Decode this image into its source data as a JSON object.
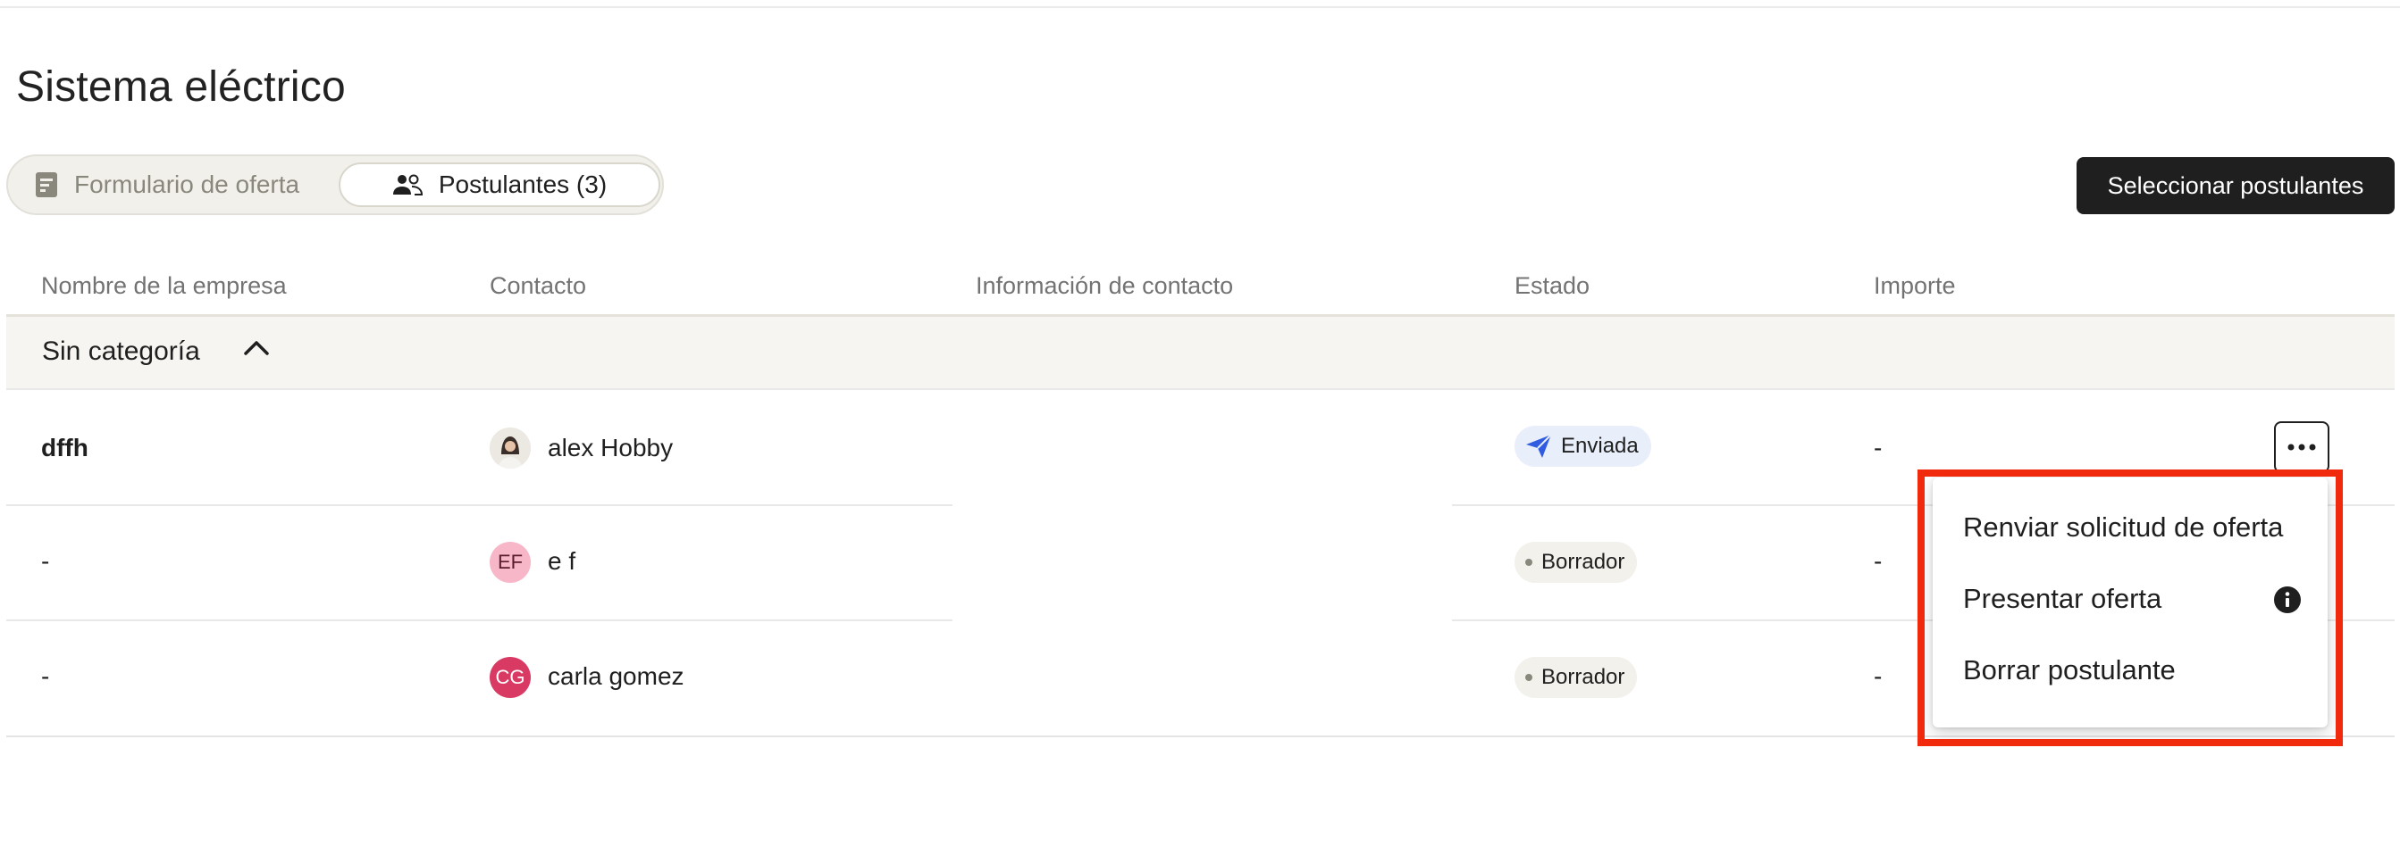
{
  "page": {
    "title": "Sistema eléctrico"
  },
  "tabs": [
    {
      "label": "Formulario de oferta",
      "icon": "form-document-icon",
      "active": false
    },
    {
      "label": "Postulantes (3)",
      "icon": "users-icon",
      "active": true
    }
  ],
  "actions": {
    "select_applicants": "Seleccionar postulantes"
  },
  "table": {
    "columns": [
      "Nombre de la empresa",
      "Contacto",
      "Información de contacto",
      "Estado",
      "Importe"
    ],
    "group": {
      "label": "Sin categoría",
      "expanded": true,
      "icon": "chevron-up-icon"
    },
    "rows": [
      {
        "company": "dffh",
        "contact": "alex Hobby",
        "avatar": "photo",
        "contact_info": "",
        "status": "Enviada",
        "status_icon": "paper-plane-icon",
        "amount": "-"
      },
      {
        "company": "-",
        "contact": "e f",
        "avatar": "EF",
        "contact_info": "",
        "status": "Borrador",
        "status_icon": "dot-icon",
        "amount": "-"
      },
      {
        "company": "-",
        "contact": "carla gomez",
        "avatar": "CG",
        "contact_info": "",
        "status": "Borrador",
        "status_icon": "dot-icon",
        "amount": "-"
      }
    ]
  },
  "menu": {
    "items": [
      {
        "label": "Renviar solicitud de oferta"
      },
      {
        "label": "Presentar oferta",
        "icon": "info-icon"
      },
      {
        "label": "Borrar postulante"
      }
    ]
  },
  "colors": {
    "primary": "#1f1f1f",
    "highlight": "#f22a0d",
    "sent_badge_bg": "#e9eefb",
    "sent_icon": "#2f5ce0",
    "draft_badge_bg": "#f3f1ec",
    "avatar_ef_bg": "#f7b7c9",
    "avatar_cg_bg": "#d93a63"
  }
}
